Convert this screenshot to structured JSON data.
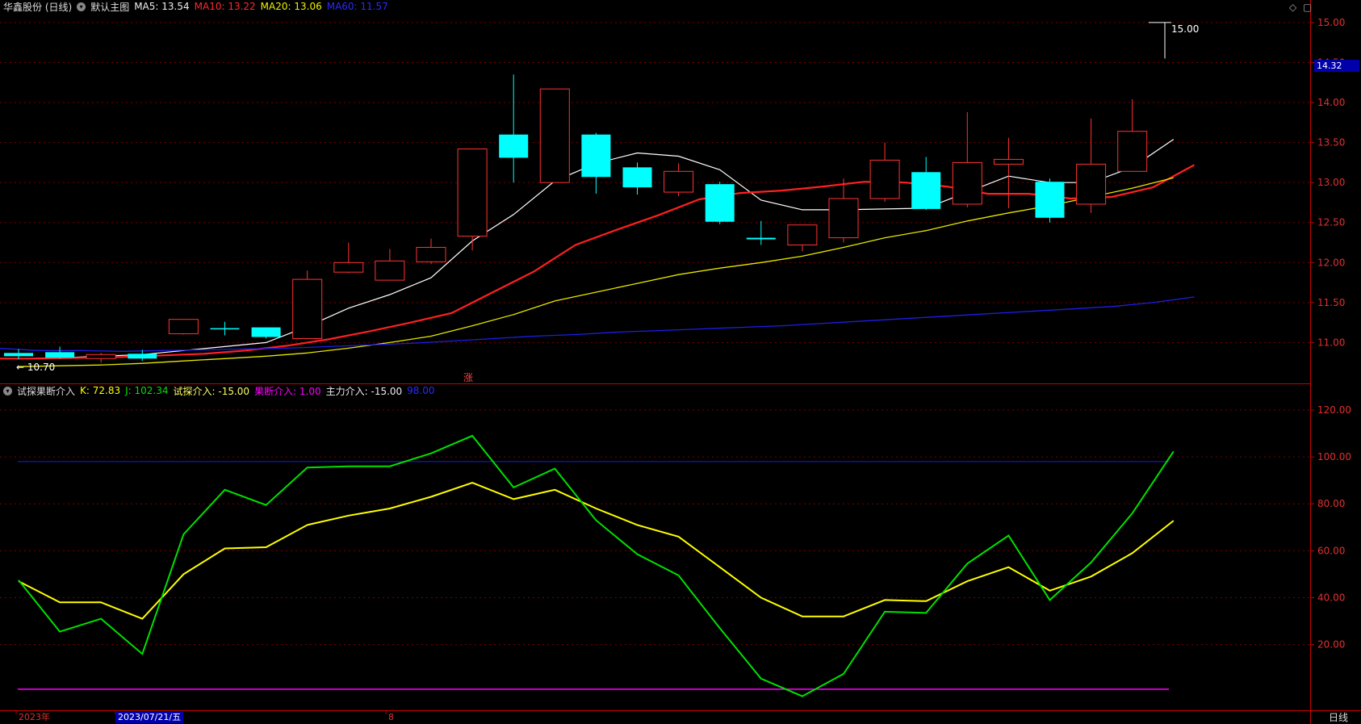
{
  "header_main": {
    "title": "华鑫股份 (日线)",
    "template": "默认主图",
    "ma5": "MA5: 13.54",
    "ma10": "MA10: 13.22",
    "ma20": "MA20: 13.06",
    "ma60": "MA60: 11.57"
  },
  "header_sub": {
    "title": "试探果断介入",
    "k": "K: 72.83",
    "j": "J: 102.34",
    "probe": "试探介入: -15.00",
    "decisive": "果断介入: 1.00",
    "main": "主力介入: -15.00",
    "level": "98.00"
  },
  "price_tag": "14.32",
  "high_label": "15.00",
  "low_label": "10.70",
  "zhang_mark": "涨",
  "period": "日线",
  "date_labels": {
    "year": "2023年",
    "cursor_date": "2023/07/21/五",
    "month": "8"
  },
  "colors": {
    "up": "#ff3232",
    "down": "#00ffff",
    "ma5": "#ffffff",
    "ma10": "#ff2020",
    "ma20": "#e6e600",
    "ma60": "#1e1ee6",
    "k": "#ffff00",
    "j": "#00e000",
    "magenta": "#ff00ff",
    "grid": "#7a0000",
    "axis": "#c80000"
  },
  "icons": {
    "menu": "chevron-down-icon",
    "diamond": "diamond-icon",
    "maximize": "maximize-icon"
  },
  "chart_data": [
    {
      "type": "candlestick",
      "title": "华鑫股份 (日线)",
      "ylim": [
        10.5,
        15.1
      ],
      "yticks": [
        11.0,
        11.5,
        12.0,
        12.5,
        13.0,
        13.5,
        14.0,
        14.5,
        15.0
      ],
      "candles": [
        {
          "o": 10.87,
          "h": 10.92,
          "l": 10.79,
          "c": 10.83
        },
        {
          "o": 10.88,
          "h": 10.95,
          "l": 10.8,
          "c": 10.81
        },
        {
          "o": 10.8,
          "h": 10.87,
          "l": 10.75,
          "c": 10.85
        },
        {
          "o": 10.86,
          "h": 10.91,
          "l": 10.77,
          "c": 10.8
        },
        {
          "o": 11.11,
          "h": 11.26,
          "l": 11.1,
          "c": 11.29
        },
        {
          "o": 11.18,
          "h": 11.26,
          "l": 11.09,
          "c": 11.17
        },
        {
          "o": 11.19,
          "h": 11.19,
          "l": 11.05,
          "c": 11.07
        },
        {
          "o": 11.05,
          "h": 11.9,
          "l": 11.05,
          "c": 11.79
        },
        {
          "o": 11.88,
          "h": 12.25,
          "l": 11.87,
          "c": 12.0
        },
        {
          "o": 11.78,
          "h": 12.17,
          "l": 11.78,
          "c": 12.02
        },
        {
          "o": 12.01,
          "h": 12.3,
          "l": 11.98,
          "c": 12.19
        },
        {
          "o": 12.33,
          "h": 13.42,
          "l": 12.15,
          "c": 13.42
        },
        {
          "o": 13.6,
          "h": 14.35,
          "l": 13.0,
          "c": 13.31
        },
        {
          "o": 13.0,
          "h": 14.17,
          "l": 13.0,
          "c": 14.17
        },
        {
          "o": 13.6,
          "h": 13.62,
          "l": 12.86,
          "c": 13.07
        },
        {
          "o": 13.19,
          "h": 13.25,
          "l": 12.85,
          "c": 12.94
        },
        {
          "o": 12.88,
          "h": 13.24,
          "l": 12.83,
          "c": 13.14
        },
        {
          "o": 12.98,
          "h": 13.01,
          "l": 12.48,
          "c": 12.51
        },
        {
          "o": 12.31,
          "h": 12.52,
          "l": 12.22,
          "c": 12.29
        },
        {
          "o": 12.22,
          "h": 12.47,
          "l": 12.14,
          "c": 12.47
        },
        {
          "o": 12.31,
          "h": 13.05,
          "l": 12.25,
          "c": 12.8
        },
        {
          "o": 12.8,
          "h": 13.5,
          "l": 12.76,
          "c": 13.28
        },
        {
          "o": 13.13,
          "h": 13.32,
          "l": 12.66,
          "c": 12.67
        },
        {
          "o": 12.73,
          "h": 13.88,
          "l": 12.69,
          "c": 13.25
        },
        {
          "o": 13.23,
          "h": 13.56,
          "l": 12.68,
          "c": 13.29
        },
        {
          "o": 13.01,
          "h": 13.05,
          "l": 12.5,
          "c": 12.56
        },
        {
          "o": 12.73,
          "h": 13.8,
          "l": 12.62,
          "c": 13.23
        },
        {
          "o": 13.14,
          "h": 14.04,
          "l": 13.14,
          "c": 13.64
        }
      ],
      "series": [
        {
          "name": "MA5",
          "values": [
            10.8,
            10.81,
            10.83,
            10.85,
            10.9,
            10.95,
            11.0,
            11.2,
            11.43,
            11.6,
            11.81,
            12.27,
            12.6,
            13.02,
            13.24,
            13.37,
            13.33,
            13.16,
            12.78,
            12.66,
            12.66,
            12.67,
            12.68,
            12.88,
            13.08,
            13.0,
            13.0,
            13.19,
            13.54
          ]
        },
        {
          "name": "MA10",
          "values": [
            10.8,
            10.8,
            10.81,
            10.82,
            10.84,
            10.86,
            10.9,
            10.96,
            11.04,
            11.14,
            11.25,
            11.37,
            11.63,
            11.89,
            12.22,
            12.41,
            12.59,
            12.79,
            12.87,
            12.9,
            12.95,
            13.01,
            13.0,
            12.95,
            12.86,
            12.86,
            12.8,
            12.82,
            12.94,
            13.22
          ]
        },
        {
          "name": "MA20",
          "values": [
            10.7,
            10.71,
            10.72,
            10.74,
            10.77,
            10.8,
            10.83,
            10.87,
            10.93,
            11.0,
            11.08,
            11.21,
            11.35,
            11.52,
            11.63,
            11.74,
            11.85,
            11.93,
            12.0,
            12.08,
            12.19,
            12.31,
            12.4,
            12.52,
            12.62,
            12.71,
            12.82,
            12.93,
            13.06
          ]
        },
        {
          "name": "MA60",
          "values": [
            10.93,
            10.9,
            10.9,
            10.89,
            10.9,
            10.91,
            10.92,
            10.93,
            10.95,
            10.97,
            10.99,
            11.02,
            11.05,
            11.08,
            11.1,
            11.13,
            11.15,
            11.17,
            11.19,
            11.21,
            11.24,
            11.27,
            11.3,
            11.33,
            11.36,
            11.39,
            11.42,
            11.45,
            11.5,
            11.57
          ]
        }
      ],
      "annotations": {
        "high": "15.00",
        "low": "10.70"
      }
    },
    {
      "type": "line",
      "title": "试探果断介入",
      "ylim": [
        -8,
        131
      ],
      "yticks": [
        20,
        40,
        60,
        80,
        100,
        120
      ],
      "series": [
        {
          "name": "K",
          "values": [
            47,
            38,
            38,
            31,
            50,
            61,
            61.5,
            71,
            75,
            78,
            83,
            89,
            82,
            86,
            78,
            71,
            66,
            53,
            40,
            32,
            32,
            39,
            38.5,
            47,
            53,
            43,
            49,
            59,
            72.83
          ]
        },
        {
          "name": "J",
          "values": [
            47.5,
            25.5,
            31,
            16,
            67,
            86,
            79.5,
            95.5,
            96,
            96,
            101.5,
            109,
            87,
            95,
            73,
            58.5,
            49.5,
            27,
            5.5,
            -2,
            7.5,
            34,
            33.5,
            54.5,
            66.5,
            39,
            55,
            76,
            102.34
          ]
        }
      ],
      "levels": {
        "blue": 98,
        "magenta": 1,
        "white": -15
      }
    }
  ]
}
